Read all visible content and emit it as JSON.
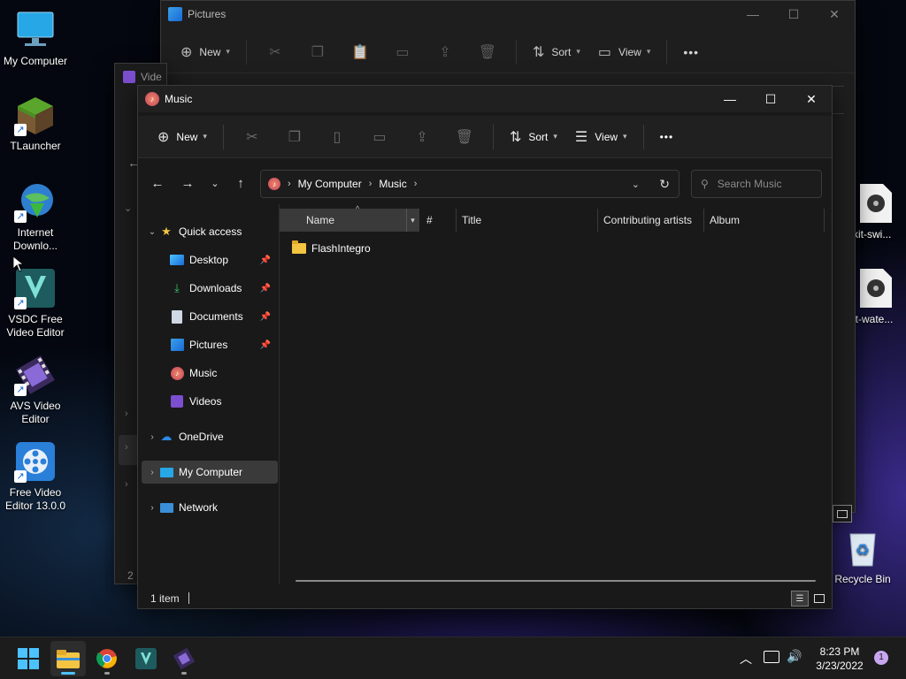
{
  "desktop": {
    "icons_left": [
      {
        "label": "My Computer"
      },
      {
        "label": "TLauncher"
      },
      {
        "label": "Internet Downlo..."
      },
      {
        "label": "VSDC Free Video Editor"
      },
      {
        "label": "AVS Video Editor"
      },
      {
        "label": "Free Video Editor 13.0.0"
      }
    ],
    "icons_right": [
      {
        "label": "kit-swi..."
      },
      {
        "label": "it-wate..."
      },
      {
        "label": "Recycle Bin"
      }
    ]
  },
  "pictures_window": {
    "title": "Pictures",
    "toolbar": {
      "new_label": "New",
      "sort_label": "Sort",
      "view_label": "View"
    }
  },
  "videos_window": {
    "title": "Vide",
    "status": "2"
  },
  "music_window": {
    "title": "Music",
    "toolbar": {
      "new_label": "New",
      "sort_label": "Sort",
      "view_label": "View",
      "more_label": "•••"
    },
    "address": {
      "crumbs": [
        "My Computer",
        "Music"
      ]
    },
    "search": {
      "placeholder": "Search Music"
    },
    "sidebar": {
      "quick_access": "Quick access",
      "items": [
        {
          "label": "Desktop",
          "pinned": true
        },
        {
          "label": "Downloads",
          "pinned": true
        },
        {
          "label": "Documents",
          "pinned": true
        },
        {
          "label": "Pictures",
          "pinned": true
        },
        {
          "label": "Music",
          "pinned": false
        },
        {
          "label": "Videos",
          "pinned": false
        }
      ],
      "onedrive": "OneDrive",
      "my_computer": "My Computer",
      "network": "Network"
    },
    "columns": [
      "Name",
      "#",
      "Title",
      "Contributing artists",
      "Album"
    ],
    "files": [
      {
        "name": "FlashIntegro",
        "type": "folder"
      }
    ],
    "status": "1 item"
  },
  "taskbar": {
    "time": "8:23 PM",
    "date": "3/23/2022",
    "notification_count": "1"
  },
  "colors": {
    "window_bg": "#202020",
    "accent": "#4cc2ff",
    "folder": "#f4c542",
    "selected_nav": "#3a3a3a"
  }
}
